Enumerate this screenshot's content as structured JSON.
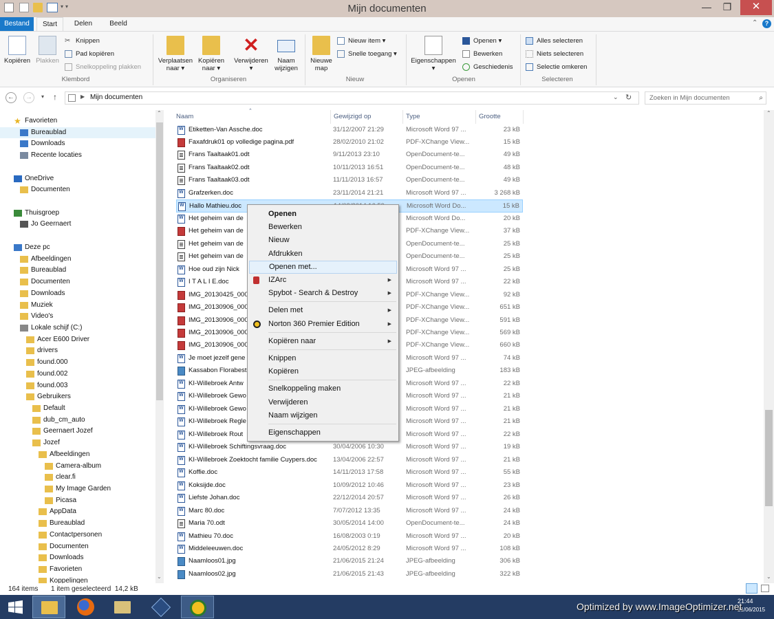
{
  "window": {
    "title": "Mijn documenten"
  },
  "ribbon_tabs": [
    "Bestand",
    "Start",
    "Delen",
    "Beeld"
  ],
  "ribbon": {
    "clipboard": {
      "copy": "Kopiëren",
      "paste": "Plakken",
      "cut": "Knippen",
      "copy_path": "Pad kopiëren",
      "paste_shortcut": "Snelkoppeling plakken",
      "group": "Klembord"
    },
    "organize": {
      "move_l1": "Verplaatsen",
      "move_l2": "naar ▾",
      "copyto_l1": "Kopiëren",
      "copyto_l2": "naar ▾",
      "delete_l1": "Verwijderen",
      "delete_l2": "▾",
      "rename_l1": "Naam",
      "rename_l2": "wijzigen",
      "group": "Organiseren"
    },
    "new": {
      "newfolder_l1": "Nieuwe",
      "newfolder_l2": "map",
      "new_item": "Nieuw item ▾",
      "easy_access": "Snelle toegang ▾",
      "group": "Nieuw"
    },
    "open": {
      "props_l1": "Eigenschappen",
      "props_l2": "▾",
      "open": "Openen ▾",
      "edit": "Bewerken",
      "history": "Geschiedenis",
      "group": "Openen"
    },
    "select": {
      "all": "Alles selecteren",
      "none": "Niets selecteren",
      "invert": "Selectie omkeren",
      "group": "Selecteren"
    }
  },
  "address": {
    "crumb": "Mijn documenten",
    "search_placeholder": "Zoeken in Mijn documenten"
  },
  "nav_items": [
    {
      "label": "Favorieten",
      "indent": 0,
      "icon": "star-icon"
    },
    {
      "label": "Bureaublad",
      "indent": 1,
      "icon": "desktop-icon",
      "selected": true
    },
    {
      "label": "Downloads",
      "indent": 1,
      "icon": "download-icon"
    },
    {
      "label": "Recente locaties",
      "indent": 1,
      "icon": "recent-icon"
    },
    {
      "label": "",
      "indent": 0,
      "icon": ""
    },
    {
      "label": "OneDrive",
      "indent": 0,
      "icon": "cloud-icon"
    },
    {
      "label": "Documenten",
      "indent": 1,
      "icon": "folder-icon"
    },
    {
      "label": "",
      "indent": 0,
      "icon": ""
    },
    {
      "label": "Thuisgroep",
      "indent": 0,
      "icon": "homegroup-icon"
    },
    {
      "label": "Jo Geernaert",
      "indent": 1,
      "icon": "user-icon"
    },
    {
      "label": "",
      "indent": 0,
      "icon": ""
    },
    {
      "label": "Deze pc",
      "indent": 0,
      "icon": "computer-icon"
    },
    {
      "label": "Afbeeldingen",
      "indent": 1,
      "icon": "folder-icon"
    },
    {
      "label": "Bureaublad",
      "indent": 1,
      "icon": "folder-icon"
    },
    {
      "label": "Documenten",
      "indent": 1,
      "icon": "folder-icon"
    },
    {
      "label": "Downloads",
      "indent": 1,
      "icon": "folder-icon"
    },
    {
      "label": "Muziek",
      "indent": 1,
      "icon": "folder-icon"
    },
    {
      "label": "Video's",
      "indent": 1,
      "icon": "folder-icon"
    },
    {
      "label": "Lokale schijf (C:)",
      "indent": 1,
      "icon": "drive-icon"
    },
    {
      "label": "Acer E600 Driver",
      "indent": 2,
      "icon": "folder-icon"
    },
    {
      "label": "drivers",
      "indent": 2,
      "icon": "folder-icon"
    },
    {
      "label": "found.000",
      "indent": 2,
      "icon": "folder-icon"
    },
    {
      "label": "found.002",
      "indent": 2,
      "icon": "folder-icon"
    },
    {
      "label": "found.003",
      "indent": 2,
      "icon": "folder-icon"
    },
    {
      "label": "Gebruikers",
      "indent": 2,
      "icon": "folder-icon"
    },
    {
      "label": "Default",
      "indent": 3,
      "icon": "folder-icon"
    },
    {
      "label": "dub_cm_auto",
      "indent": 3,
      "icon": "folder-icon"
    },
    {
      "label": "Geernaert Jozef",
      "indent": 3,
      "icon": "folder-icon"
    },
    {
      "label": "Jozef",
      "indent": 3,
      "icon": "folder-icon"
    },
    {
      "label": "Afbeeldingen",
      "indent": 4,
      "icon": "folder-icon"
    },
    {
      "label": "Camera-album",
      "indent": 5,
      "icon": "folder-icon"
    },
    {
      "label": "clear.fi",
      "indent": 5,
      "icon": "folder-icon"
    },
    {
      "label": "My Image Garden",
      "indent": 5,
      "icon": "folder-icon"
    },
    {
      "label": "Picasa",
      "indent": 5,
      "icon": "folder-icon"
    },
    {
      "label": "AppData",
      "indent": 4,
      "icon": "folder-icon"
    },
    {
      "label": "Bureaublad",
      "indent": 4,
      "icon": "folder-icon"
    },
    {
      "label": "Contactpersonen",
      "indent": 4,
      "icon": "folder-icon"
    },
    {
      "label": "Documenten",
      "indent": 4,
      "icon": "folder-icon"
    },
    {
      "label": "Downloads",
      "indent": 4,
      "icon": "folder-icon"
    },
    {
      "label": "Favorieten",
      "indent": 4,
      "icon": "folder-icon"
    },
    {
      "label": "Koppelingen",
      "indent": 4,
      "icon": "folder-icon"
    }
  ],
  "columns": {
    "name": "Naam",
    "modified": "Gewijzigd op",
    "type": "Type",
    "size": "Grootte"
  },
  "files": [
    {
      "name": "Etiketten-Van Assche.doc",
      "date": "31/12/2007 21:29",
      "type": "Microsoft Word 97 ...",
      "size": "23 kB",
      "kind": "w"
    },
    {
      "name": "Faxafdruk01 op volledige pagina.pdf",
      "date": "28/02/2010 21:02",
      "type": "PDF-XChange View...",
      "size": "15 kB",
      "kind": "p"
    },
    {
      "name": "Frans Taaltaak01.odt",
      "date": "9/11/2013 23:10",
      "type": "OpenDocument-te...",
      "size": "49 kB",
      "kind": "o"
    },
    {
      "name": "Frans Taaltaak02.odt",
      "date": "10/11/2013 16:51",
      "type": "OpenDocument-te...",
      "size": "48 kB",
      "kind": "o"
    },
    {
      "name": "Frans Taaltaak03.odt",
      "date": "11/11/2013 16:57",
      "type": "OpenDocument-te...",
      "size": "49 kB",
      "kind": "o"
    },
    {
      "name": "Grafzerken.doc",
      "date": "23/11/2014 21:21",
      "type": "Microsoft Word 97 ...",
      "size": "3 268 kB",
      "kind": "w"
    },
    {
      "name": "Hallo Mathieu.doc",
      "date": "14/02/2014 16:59",
      "type": "Microsoft Word Do...",
      "size": "15 kB",
      "kind": "w",
      "selected": true
    },
    {
      "name": "Het geheim van de",
      "date": "",
      "type": "Microsoft Word Do...",
      "size": "20 kB",
      "kind": "w"
    },
    {
      "name": "Het geheim van de",
      "date": "",
      "type": "PDF-XChange View...",
      "size": "37 kB",
      "kind": "p"
    },
    {
      "name": "Het geheim van de",
      "date": "",
      "type": "OpenDocument-te...",
      "size": "25 kB",
      "kind": "o"
    },
    {
      "name": "Het geheim van de",
      "date": "",
      "type": "OpenDocument-te...",
      "size": "25 kB",
      "kind": "o"
    },
    {
      "name": "Hoe oud zijn Nick",
      "date": "",
      "type": "Microsoft Word 97 ...",
      "size": "25 kB",
      "kind": "w"
    },
    {
      "name": "I T A L I E.doc",
      "date": "",
      "type": "Microsoft Word 97 ...",
      "size": "22 kB",
      "kind": "w"
    },
    {
      "name": "IMG_20130425_000",
      "date": "",
      "type": "PDF-XChange View...",
      "size": "92 kB",
      "kind": "p"
    },
    {
      "name": "IMG_20130906_000",
      "date": "",
      "type": "PDF-XChange View...",
      "size": "651 kB",
      "kind": "p"
    },
    {
      "name": "IMG_20130906_000",
      "date": "",
      "type": "PDF-XChange View...",
      "size": "591 kB",
      "kind": "p"
    },
    {
      "name": "IMG_20130906_000",
      "date": "",
      "type": "PDF-XChange View...",
      "size": "569 kB",
      "kind": "p"
    },
    {
      "name": "IMG_20130906_000",
      "date": "",
      "type": "PDF-XChange View...",
      "size": "660 kB",
      "kind": "p"
    },
    {
      "name": "Je moet jezelf gene",
      "date": "",
      "type": "Microsoft Word 97 ...",
      "size": "74 kB",
      "kind": "w"
    },
    {
      "name": "Kassabon Florabest",
      "date": "",
      "type": "JPEG-afbeelding",
      "size": "183 kB",
      "kind": "j"
    },
    {
      "name": "KI-Willebroek Antw",
      "date": "",
      "type": "Microsoft Word 97 ...",
      "size": "22 kB",
      "kind": "w"
    },
    {
      "name": "KI-Willebroek Gewo",
      "date": "",
      "type": "Microsoft Word 97 ...",
      "size": "21 kB",
      "kind": "w"
    },
    {
      "name": "KI-Willebroek Gewo",
      "date": "",
      "type": "Microsoft Word 97 ...",
      "size": "21 kB",
      "kind": "w"
    },
    {
      "name": "KI-Willebroek Regle",
      "date": "",
      "type": "Microsoft Word 97 ...",
      "size": "21 kB",
      "kind": "w"
    },
    {
      "name": "KI-Willebroek Rout",
      "date": "",
      "type": "Microsoft Word 97 ...",
      "size": "22 kB",
      "kind": "w"
    },
    {
      "name": "KI-Willebroek Schiftingsvraag.doc",
      "date": "30/04/2006 10:30",
      "type": "Microsoft Word 97 ...",
      "size": "19 kB",
      "kind": "w"
    },
    {
      "name": "KI-Willebroek Zoektocht familie Cuypers.doc",
      "date": "13/04/2006 22:57",
      "type": "Microsoft Word 97 ...",
      "size": "21 kB",
      "kind": "w"
    },
    {
      "name": "Koffie.doc",
      "date": "14/11/2013 17:58",
      "type": "Microsoft Word 97 ...",
      "size": "55 kB",
      "kind": "w"
    },
    {
      "name": "Koksijde.doc",
      "date": "10/09/2012 10:46",
      "type": "Microsoft Word 97 ...",
      "size": "23 kB",
      "kind": "w"
    },
    {
      "name": "Liefste Johan.doc",
      "date": "22/12/2014 20:57",
      "type": "Microsoft Word 97 ...",
      "size": "26 kB",
      "kind": "w"
    },
    {
      "name": "Marc 80.doc",
      "date": "7/07/2012 13:35",
      "type": "Microsoft Word 97 ...",
      "size": "24 kB",
      "kind": "w"
    },
    {
      "name": "Maria 70.odt",
      "date": "30/05/2014 14:00",
      "type": "OpenDocument-te...",
      "size": "24 kB",
      "kind": "o"
    },
    {
      "name": "Mathieu 70.doc",
      "date": "16/08/2003 0:19",
      "type": "Microsoft Word 97 ...",
      "size": "20 kB",
      "kind": "w"
    },
    {
      "name": "Middeleeuwen.doc",
      "date": "24/05/2012 8:29",
      "type": "Microsoft Word 97 ...",
      "size": "108 kB",
      "kind": "w"
    },
    {
      "name": "Naamloos01.jpg",
      "date": "21/06/2015 21:24",
      "type": "JPEG-afbeelding",
      "size": "306 kB",
      "kind": "j"
    },
    {
      "name": "Naamloos02.jpg",
      "date": "21/06/2015 21:43",
      "type": "JPEG-afbeelding",
      "size": "322 kB",
      "kind": "j"
    }
  ],
  "context_menu": [
    {
      "label": "Openen",
      "bold": true,
      "name": "ctx-open"
    },
    {
      "label": "Bewerken",
      "name": "ctx-edit"
    },
    {
      "label": "Nieuw",
      "name": "ctx-new"
    },
    {
      "label": "Afdrukken",
      "name": "ctx-print"
    },
    {
      "label": "Openen met...",
      "highlight": true,
      "name": "ctx-open-with"
    },
    {
      "label": "IZArc",
      "arrow": true,
      "icon": "izarc-icon",
      "name": "ctx-izarc"
    },
    {
      "label": "Spybot - Search & Destroy",
      "arrow": true,
      "name": "ctx-spybot"
    },
    {
      "sep": true
    },
    {
      "label": "Delen met",
      "arrow": true,
      "name": "ctx-share-with"
    },
    {
      "label": "Norton 360 Premier Edition",
      "arrow": true,
      "icon": "norton-icon",
      "name": "ctx-norton"
    },
    {
      "sep": true
    },
    {
      "label": "Kopiëren naar",
      "arrow": true,
      "name": "ctx-copy-to"
    },
    {
      "sep": true
    },
    {
      "label": "Knippen",
      "name": "ctx-cut"
    },
    {
      "label": "Kopiëren",
      "name": "ctx-copy"
    },
    {
      "sep": true
    },
    {
      "label": "Snelkoppeling maken",
      "name": "ctx-create-shortcut"
    },
    {
      "label": "Verwijderen",
      "name": "ctx-delete"
    },
    {
      "label": "Naam wijzigen",
      "name": "ctx-rename"
    },
    {
      "sep": true
    },
    {
      "label": "Eigenschappen",
      "name": "ctx-properties"
    }
  ],
  "status": {
    "count": "164 items",
    "selection": "1 item geselecteerd  14,2 kB"
  },
  "taskbar": {
    "time": "21:44",
    "date": "21/06/2015"
  },
  "watermark": "Optimized by www.ImageOptimizer.net",
  "colors": {
    "accent": "#1979ca",
    "selection": "#cce8ff",
    "taskbar": "#243c63",
    "titlebar": "#d6c8c0",
    "close": "#c75050"
  }
}
